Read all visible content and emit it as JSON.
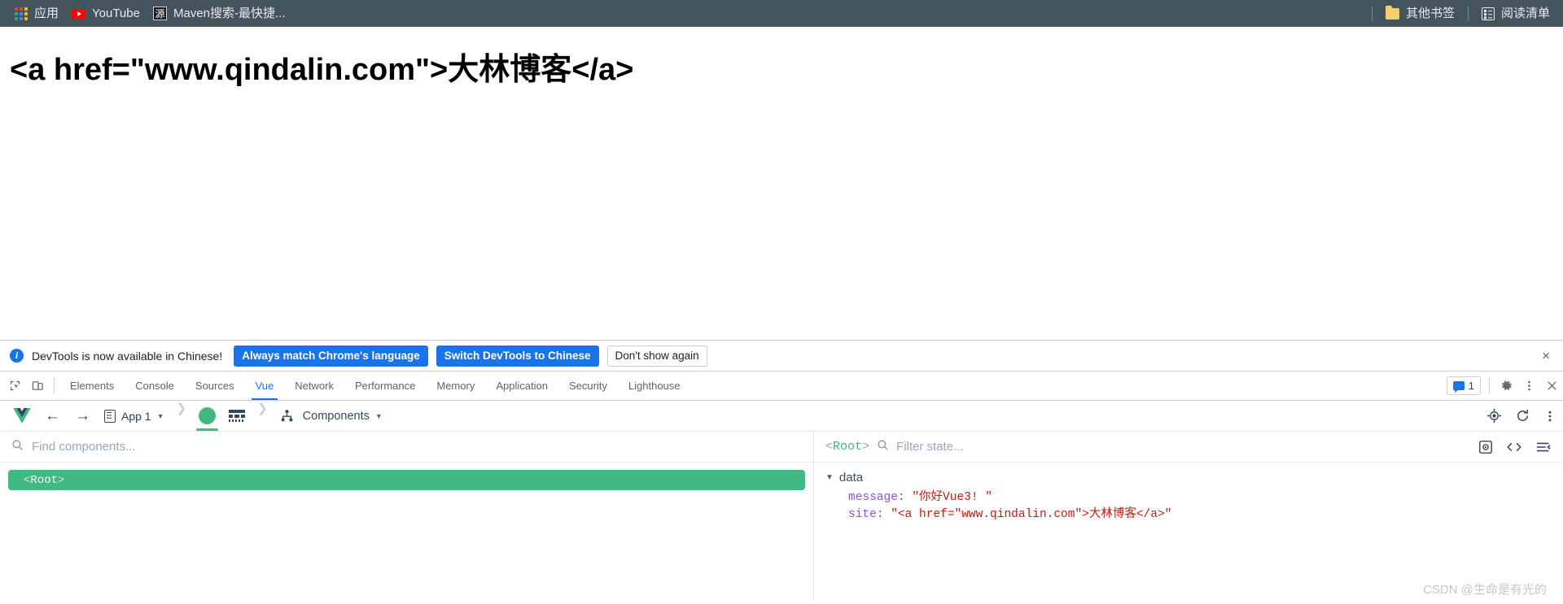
{
  "browser": {
    "bookmarks": [
      {
        "label": "应用",
        "icon": "apps-grid-icon"
      },
      {
        "label": "YouTube",
        "icon": "youtube-icon"
      },
      {
        "label": "Maven搜索-最快捷...",
        "icon": "maven-icon",
        "icon_text": "源"
      }
    ],
    "right_items": [
      {
        "label": "其他书签",
        "icon": "folder-icon"
      },
      {
        "label": "阅读清单",
        "icon": "reading-list-icon"
      }
    ]
  },
  "page": {
    "heading": "<a href=\"www.qindalin.com\">大林博客</a>"
  },
  "devtools_notice": {
    "message": "DevTools is now available in Chinese!",
    "buttons": [
      {
        "label": "Always match Chrome's language",
        "style": "primary"
      },
      {
        "label": "Switch DevTools to Chinese",
        "style": "primary"
      },
      {
        "label": "Don't show again",
        "style": "secondary"
      }
    ],
    "close_label": "×"
  },
  "devtools_tabs": {
    "items": [
      "Elements",
      "Console",
      "Sources",
      "Vue",
      "Network",
      "Performance",
      "Memory",
      "Application",
      "Security",
      "Lighthouse"
    ],
    "active": "Vue",
    "message_count": "1"
  },
  "vue_toolbar": {
    "app_label": "App 1",
    "section_label": "Components"
  },
  "components_panel": {
    "search_placeholder": "Find components...",
    "tree": [
      {
        "label": "Root",
        "selected": true
      }
    ]
  },
  "state_panel": {
    "root_label": "Root",
    "filter_placeholder": "Filter state...",
    "group_label": "data",
    "entries": [
      {
        "key": "message",
        "value": "\"你好Vue3! \""
      },
      {
        "key": "site",
        "value": "\"<a href=\"www.qindalin.com\">大林博客</a>\""
      }
    ]
  },
  "watermark": {
    "text": "CSDN @生命是有光的"
  },
  "colors": {
    "bookmark_bar_bg": "#44545c",
    "vue_green": "#42b883",
    "chrome_blue": "#1a73e8",
    "string_red": "#c41a16",
    "key_purple": "#9052d1"
  }
}
